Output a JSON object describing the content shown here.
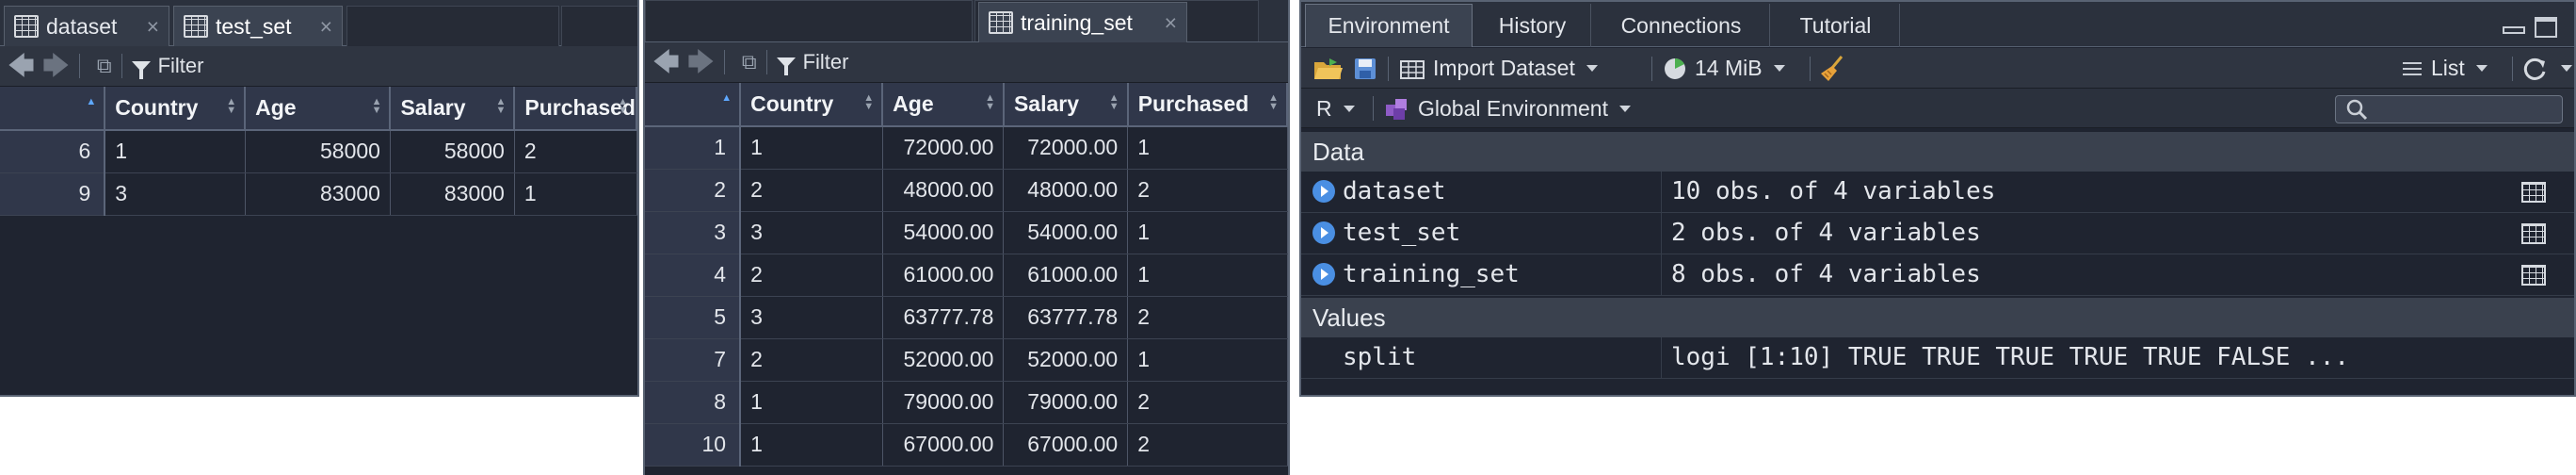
{
  "panel1": {
    "tabs": [
      {
        "label": "dataset",
        "close": "×"
      },
      {
        "label": "test_set",
        "close": "×"
      }
    ],
    "filter_label": "Filter",
    "columns": [
      "Country",
      "Age",
      "Salary",
      "Purchased"
    ],
    "rows": [
      {
        "rn": "6",
        "c": [
          "1",
          "58000",
          "58000",
          "2"
        ]
      },
      {
        "rn": "9",
        "c": [
          "3",
          "83000",
          "83000",
          "1"
        ]
      }
    ]
  },
  "panel2": {
    "tab": {
      "label": "training_set",
      "close": "×"
    },
    "filter_label": "Filter",
    "columns": [
      "Country",
      "Age",
      "Salary",
      "Purchased"
    ],
    "rows": [
      {
        "rn": "1",
        "c": [
          "1",
          "72000.00",
          "72000.00",
          "1"
        ]
      },
      {
        "rn": "2",
        "c": [
          "2",
          "48000.00",
          "48000.00",
          "2"
        ]
      },
      {
        "rn": "3",
        "c": [
          "3",
          "54000.00",
          "54000.00",
          "1"
        ]
      },
      {
        "rn": "4",
        "c": [
          "2",
          "61000.00",
          "61000.00",
          "1"
        ]
      },
      {
        "rn": "5",
        "c": [
          "3",
          "63777.78",
          "63777.78",
          "2"
        ]
      },
      {
        "rn": "7",
        "c": [
          "2",
          "52000.00",
          "52000.00",
          "1"
        ]
      },
      {
        "rn": "8",
        "c": [
          "1",
          "79000.00",
          "79000.00",
          "2"
        ]
      },
      {
        "rn": "10",
        "c": [
          "1",
          "67000.00",
          "67000.00",
          "2"
        ]
      }
    ]
  },
  "env": {
    "tabs": [
      "Environment",
      "History",
      "Connections",
      "Tutorial"
    ],
    "import_label": "Import Dataset",
    "memory_label": "14 MiB",
    "list_label": "List",
    "lang_label": "R",
    "scope_label": "Global Environment",
    "data_section": "Data",
    "values_section": "Values",
    "data_rows": [
      {
        "name": "dataset",
        "value": "10 obs. of 4 variables"
      },
      {
        "name": "test_set",
        "value": "2 obs. of 4 variables"
      },
      {
        "name": "training_set",
        "value": "8 obs. of 4 variables"
      }
    ],
    "value_rows": [
      {
        "name": "split",
        "value": "logi [1:10] TRUE TRUE TRUE TRUE TRUE FALSE ..."
      }
    ],
    "colors": {
      "accent": "#4a8fe3",
      "panel_bg": "#1f2430",
      "header_bg": "#30374a"
    }
  }
}
